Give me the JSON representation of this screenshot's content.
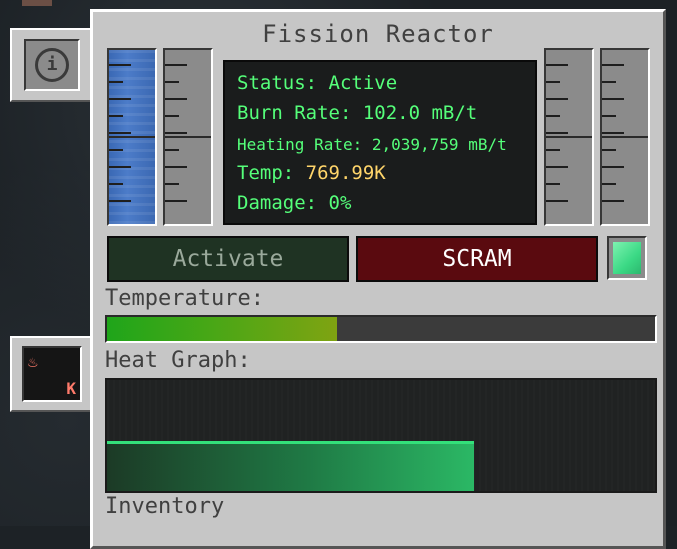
{
  "window": {
    "title": "Fission Reactor"
  },
  "status": {
    "status_line": "Status: Active",
    "burn_rate_line": "Burn Rate: 102.0 mB/t",
    "heating_rate_line": "Heating Rate: 2,039,759 mB/t",
    "temp_label": "Temp: ",
    "temp_value": "769.99K",
    "damage_line": "Damage: 0%"
  },
  "buttons": {
    "activate": "Activate",
    "scram": "SCRAM"
  },
  "temperature": {
    "label": "Temperature:",
    "fill_fraction": 0.42
  },
  "heat_graph": {
    "label": "Heat Graph:",
    "fill_fraction": 0.67,
    "level_fraction": 0.45
  },
  "inventory": {
    "label": "Inventory"
  },
  "gauges": {
    "left_1_fluid": "water",
    "left_2_fluid": "empty",
    "right_1_fluid": "empty",
    "right_2_fluid": "empty"
  },
  "side_tabs": {
    "info_icon": "info-icon",
    "temperature_unit": "K"
  },
  "colors": {
    "status_text": "#55ff7a",
    "temp_value": "#ffd56a",
    "activate_bg": "#1f3323",
    "scram_bg": "#5a0a0f",
    "temperature_bar": "#48a716",
    "graph_fill": "#2bb865"
  }
}
